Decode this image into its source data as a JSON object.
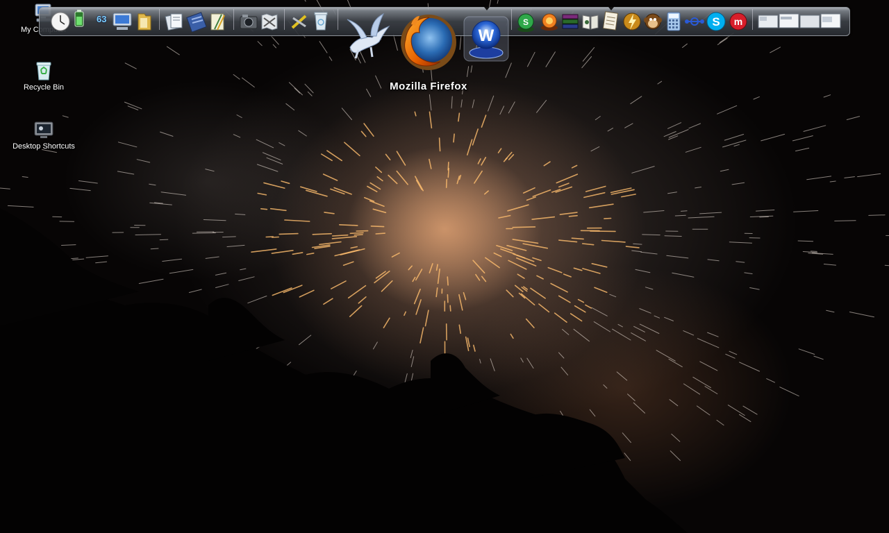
{
  "desktop": {
    "icons": [
      {
        "label": "My Computer",
        "icon": "my-computer-icon"
      },
      {
        "label": "Recycle Bin",
        "icon": "recycle-bin-icon"
      },
      {
        "label": "Desktop Shortcuts",
        "icon": "desktop-shortcuts-icon"
      }
    ],
    "wallpaper": "fireworks-night"
  },
  "dock": {
    "counter_text": "63",
    "hover_label": "Mozilla Firefox",
    "items": [
      "clock-icon",
      "battery-icon",
      "counter-icon",
      "monitor-icon",
      "folder-icon",
      "files-icon",
      "notebook-icon",
      "pencils-icon",
      "camera-icon",
      "map-icon",
      "tools-icon",
      "trash-icon",
      "pegasus-icon",
      "firefox-icon",
      "webroot-icon",
      "green-app-icon",
      "orange-app-icon",
      "winrar-icon",
      "book-icon",
      "notes-icon",
      "bolt-icon",
      "monkey-icon",
      "calculator-icon",
      "network-icon",
      "skype-icon",
      "m-icon",
      "windows-preview-icon"
    ]
  },
  "colors": {
    "dock_top": "#b8bcc2",
    "dock_bottom": "#2a2e33",
    "firefox_orange": "#e66000",
    "firefox_blue": "#2b6cb4",
    "skype_blue": "#00aff0"
  }
}
